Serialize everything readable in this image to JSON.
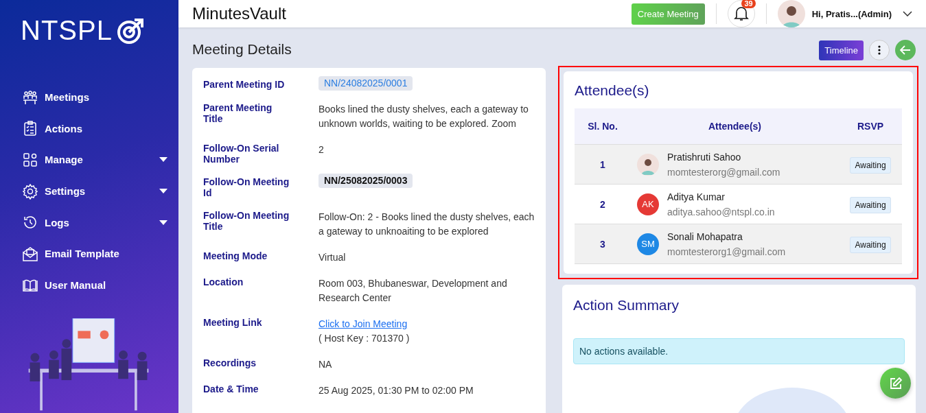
{
  "sidebar": {
    "logo": "NTSPL",
    "items": [
      {
        "label": "Meetings",
        "has_submenu": false
      },
      {
        "label": "Actions",
        "has_submenu": false
      },
      {
        "label": "Manage",
        "has_submenu": true
      },
      {
        "label": "Settings",
        "has_submenu": true
      },
      {
        "label": "Logs",
        "has_submenu": true
      },
      {
        "label": "Email Template",
        "has_submenu": false
      },
      {
        "label": "User Manual",
        "has_submenu": false
      }
    ]
  },
  "header": {
    "title": "MinutesVault",
    "create_button": "Create Meeting",
    "notification_count": "39",
    "user": "Hi, Pratis...(Admin)"
  },
  "page": {
    "title": "Meeting Details",
    "timeline_button": "Timeline"
  },
  "details": [
    {
      "label": "Parent Meeting ID",
      "kind": "badge",
      "value": "NN/24082025/0001",
      "linked": true
    },
    {
      "label": "Parent Meeting Title",
      "kind": "text",
      "value": "Books lined the dusty shelves, each a gateway to unknown worlds, waiting to be explored. Zoom"
    },
    {
      "label": "Follow-On Serial Number",
      "kind": "text",
      "value": "2"
    },
    {
      "label": "Follow-On Meeting Id",
      "kind": "badge",
      "value": "NN/25082025/0003",
      "linked": false
    },
    {
      "label": "Follow-On Meeting Title",
      "kind": "text",
      "value": "Follow-On: 2 - Books lined the dusty shelves, each a gateway to unknoaiting to be explored"
    },
    {
      "label": "Meeting Mode",
      "kind": "text",
      "value": "Virtual"
    },
    {
      "label": "Location",
      "kind": "text",
      "value": "Room 003, Bhubaneswar, Development and Research Center"
    },
    {
      "label": "Meeting Link",
      "kind": "link",
      "value": "Click to Join Meeting",
      "note": "( Host Key : 701370 )"
    },
    {
      "label": "Recordings",
      "kind": "text",
      "value": "NA"
    },
    {
      "label": "Date & Time",
      "kind": "text",
      "value": "25 Aug 2025, 01:30 PM to 02:00 PM"
    }
  ],
  "attendees": {
    "title": "Attendee(s)",
    "highlighted": true,
    "columns": [
      "Sl. No.",
      "Attendee(s)",
      "RSVP"
    ],
    "rows": [
      {
        "number": "1",
        "kind": "photo",
        "name": "Pratishruti Sahoo",
        "email": "momtesterorg@gmail.com",
        "rsvp": "Awaiting"
      },
      {
        "number": "2",
        "kind": "initials",
        "initials": "AK",
        "color": "#e53935",
        "name": "Aditya Kumar",
        "email": "aditya.sahoo@ntspl.co.in",
        "rsvp": "Awaiting"
      },
      {
        "number": "3",
        "kind": "initials",
        "initials": "SM",
        "color": "#1e88e5",
        "name": "Sonali Mohapatra",
        "email": "momtesterorg1@gmail.com",
        "rsvp": "Awaiting"
      }
    ]
  },
  "action_summary": {
    "title": "Action Summary",
    "message": "No actions available."
  }
}
